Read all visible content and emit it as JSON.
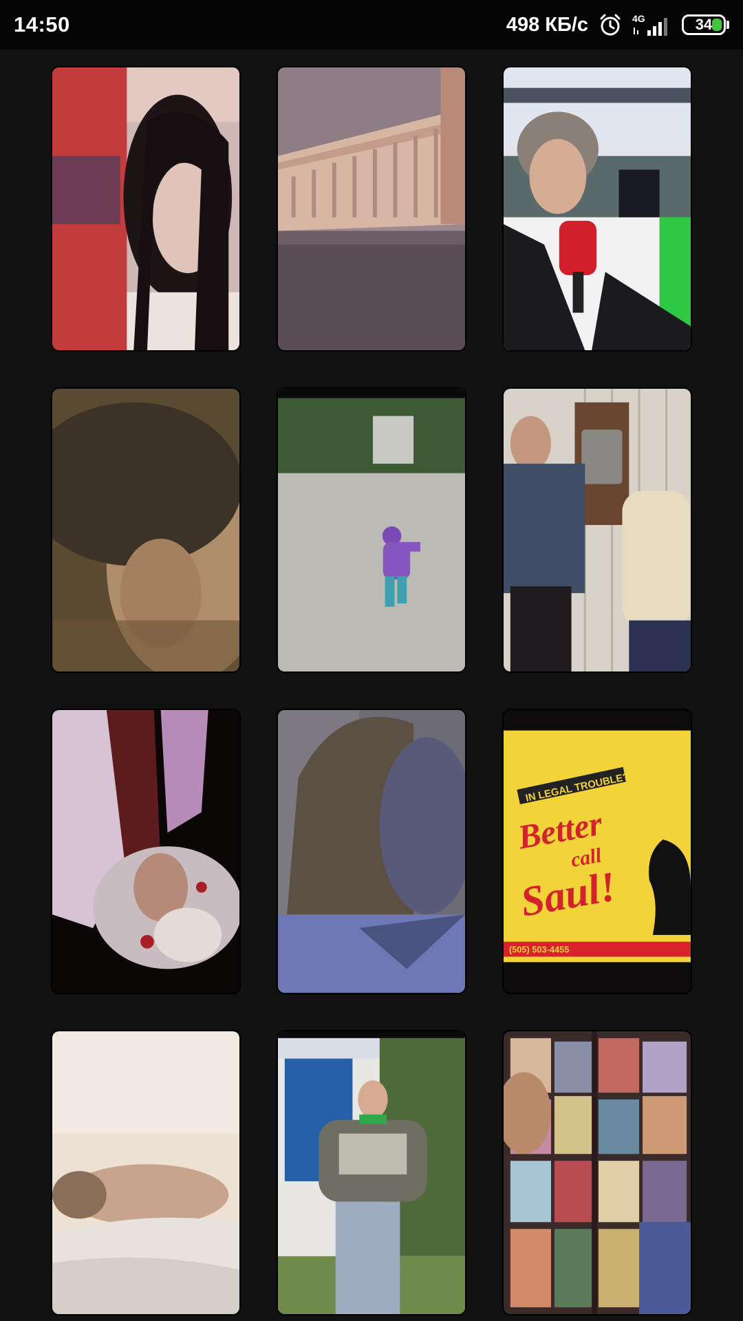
{
  "status_bar": {
    "time": "14:50",
    "net_speed": "498 КБ/с",
    "network_type": "4G",
    "battery_level": "34",
    "icons": [
      "alarm-icon",
      "signal-icon",
      "battery-icon"
    ]
  },
  "gallery": {
    "tiles": [
      {
        "name": "video-thumbnail-girl-portrait"
      },
      {
        "name": "video-thumbnail-apartment-building"
      },
      {
        "name": "video-thumbnail-reporter-microphone"
      },
      {
        "name": "video-thumbnail-blurred-face"
      },
      {
        "name": "video-thumbnail-child-running"
      },
      {
        "name": "video-thumbnail-man-on-phone"
      },
      {
        "name": "video-thumbnail-dark-figure"
      },
      {
        "name": "video-thumbnail-woman-blue"
      },
      {
        "name": "video-thumbnail-better-call-saul"
      },
      {
        "name": "video-thumbnail-man-lying"
      },
      {
        "name": "video-thumbnail-man-walking"
      },
      {
        "name": "video-thumbnail-magazine-stand"
      }
    ],
    "poster_text": {
      "headline": "IN LEGAL TROUBLE?",
      "line1": "Better",
      "line2": "call",
      "line3": "Saul!",
      "phone": "(505) 503-4455"
    }
  }
}
